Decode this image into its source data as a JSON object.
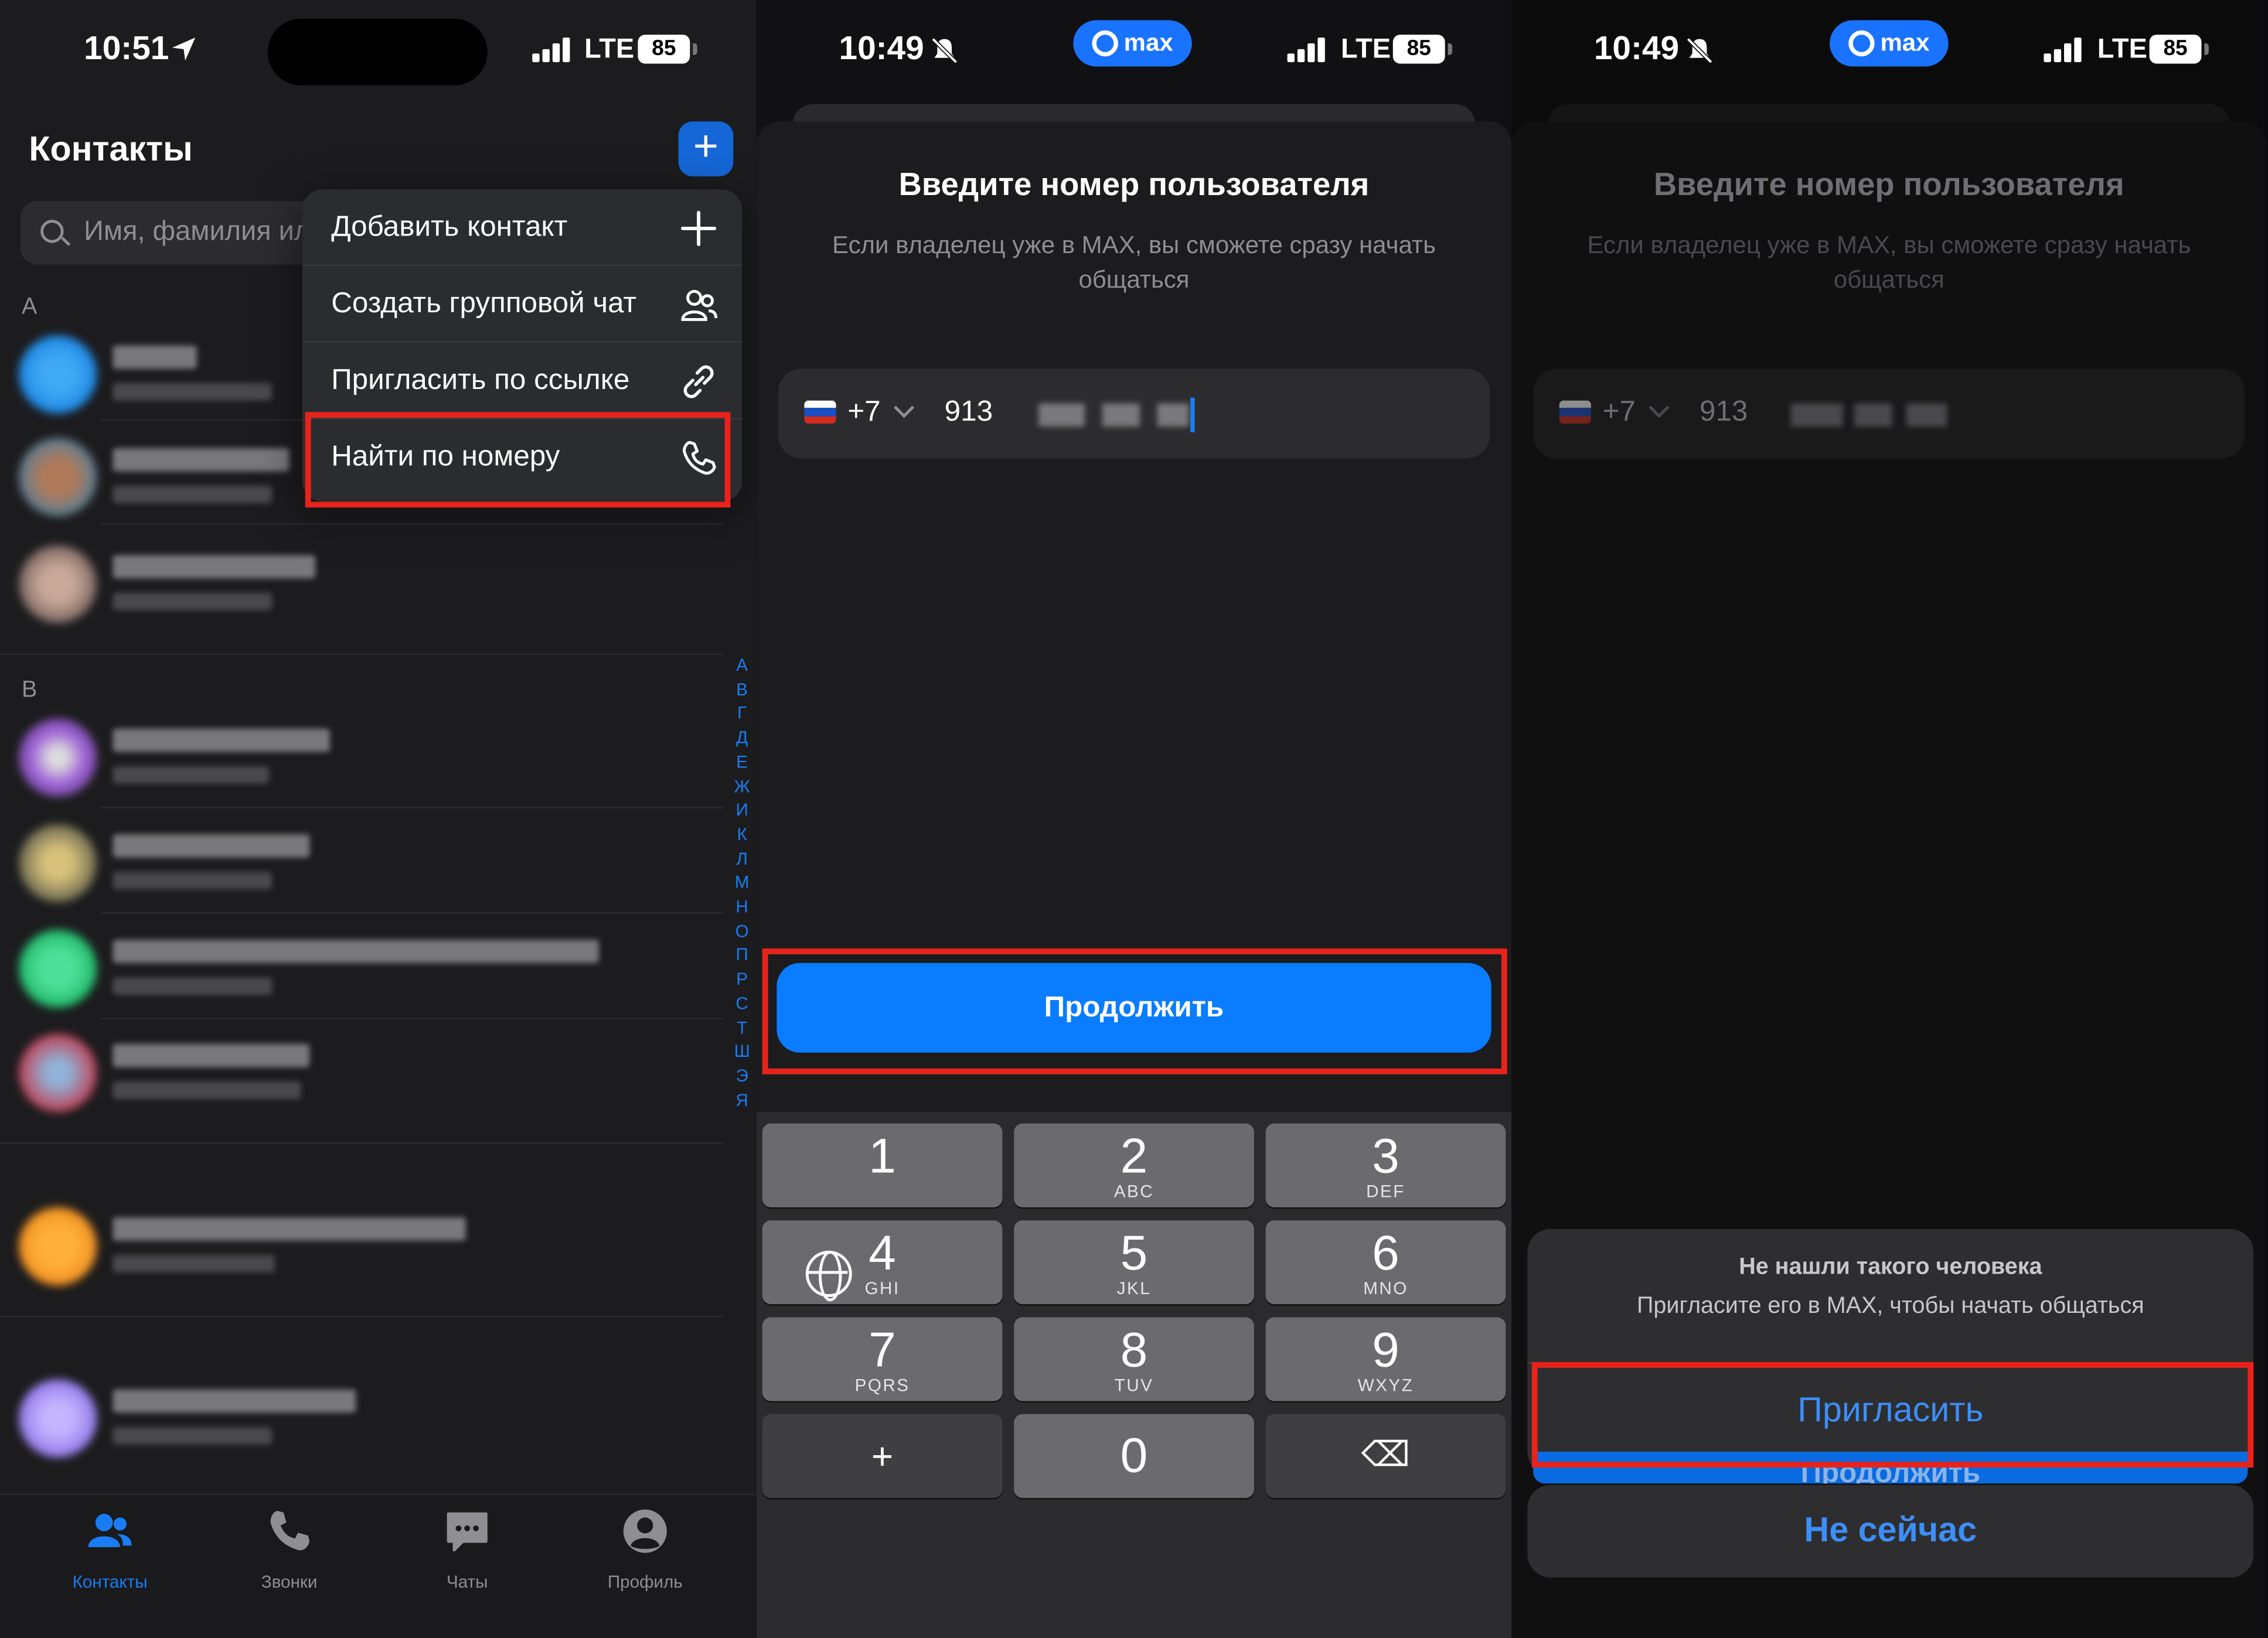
{
  "screen1": {
    "status": {
      "time": "10:51",
      "network": "LTE",
      "battery": "85"
    },
    "title": "Контакты",
    "add_button": "+",
    "search": {
      "placeholder": "Имя, фамилия или номер"
    },
    "section_letters": [
      "А",
      "В"
    ],
    "index_letters": [
      "А",
      "В",
      "Г",
      "Д",
      "Е",
      "Ж",
      "И",
      "К",
      "Л",
      "М",
      "Н",
      "О",
      "П",
      "Р",
      "С",
      "Т",
      "Ш",
      "Э",
      "Я"
    ],
    "menu": [
      {
        "label": "Добавить контакт",
        "icon": "plus-icon"
      },
      {
        "label": "Создать групповой чат",
        "icon": "group-icon"
      },
      {
        "label": "Пригласить по ссылке",
        "icon": "link-icon"
      },
      {
        "label": "Найти по номеру",
        "icon": "phone-icon"
      }
    ],
    "tabs": [
      {
        "label": "Контакты",
        "icon": "contacts-icon",
        "active": true
      },
      {
        "label": "Звонки",
        "icon": "phone-icon"
      },
      {
        "label": "Чаты",
        "icon": "chat-icon"
      },
      {
        "label": "Профиль",
        "icon": "profile-icon"
      }
    ]
  },
  "screen2": {
    "status": {
      "time": "10:49",
      "network": "LTE",
      "battery": "85",
      "pill": "max"
    },
    "heading": "Введите номер пользователя",
    "subtitle": "Если владелец уже в MAX, вы сможете сразу начать общаться",
    "country_code": "+7",
    "number_prefix": "913",
    "continue_label": "Продолжить",
    "keys": [
      {
        "digit": "1",
        "letters": ""
      },
      {
        "digit": "2",
        "letters": "ABC"
      },
      {
        "digit": "3",
        "letters": "DEF"
      },
      {
        "digit": "4",
        "letters": "GHI"
      },
      {
        "digit": "5",
        "letters": "JKL"
      },
      {
        "digit": "6",
        "letters": "MNO"
      },
      {
        "digit": "7",
        "letters": "PQRS"
      },
      {
        "digit": "8",
        "letters": "TUV"
      },
      {
        "digit": "9",
        "letters": "WXYZ"
      },
      {
        "digit": "+",
        "letters": ""
      },
      {
        "digit": "0",
        "letters": ""
      },
      {
        "digit": "⌫",
        "letters": ""
      }
    ]
  },
  "screen3": {
    "status": {
      "time": "10:49",
      "network": "LTE",
      "battery": "85",
      "pill": "max"
    },
    "heading": "Введите номер пользователя",
    "subtitle": "Если владелец уже в MAX, вы сможете сразу начать общаться",
    "country_code": "+7",
    "number_prefix": "913",
    "alert": {
      "title": "Не нашли такого человека",
      "message": "Пригласите его в MAX, чтобы начать общаться",
      "invite": "Пригласить",
      "behind": "Продолжить",
      "cancel": "Не сейчас"
    }
  },
  "colors": {
    "accent": "#0a7cff",
    "highlight": "#e8231b",
    "background": "#1c1c1e"
  }
}
